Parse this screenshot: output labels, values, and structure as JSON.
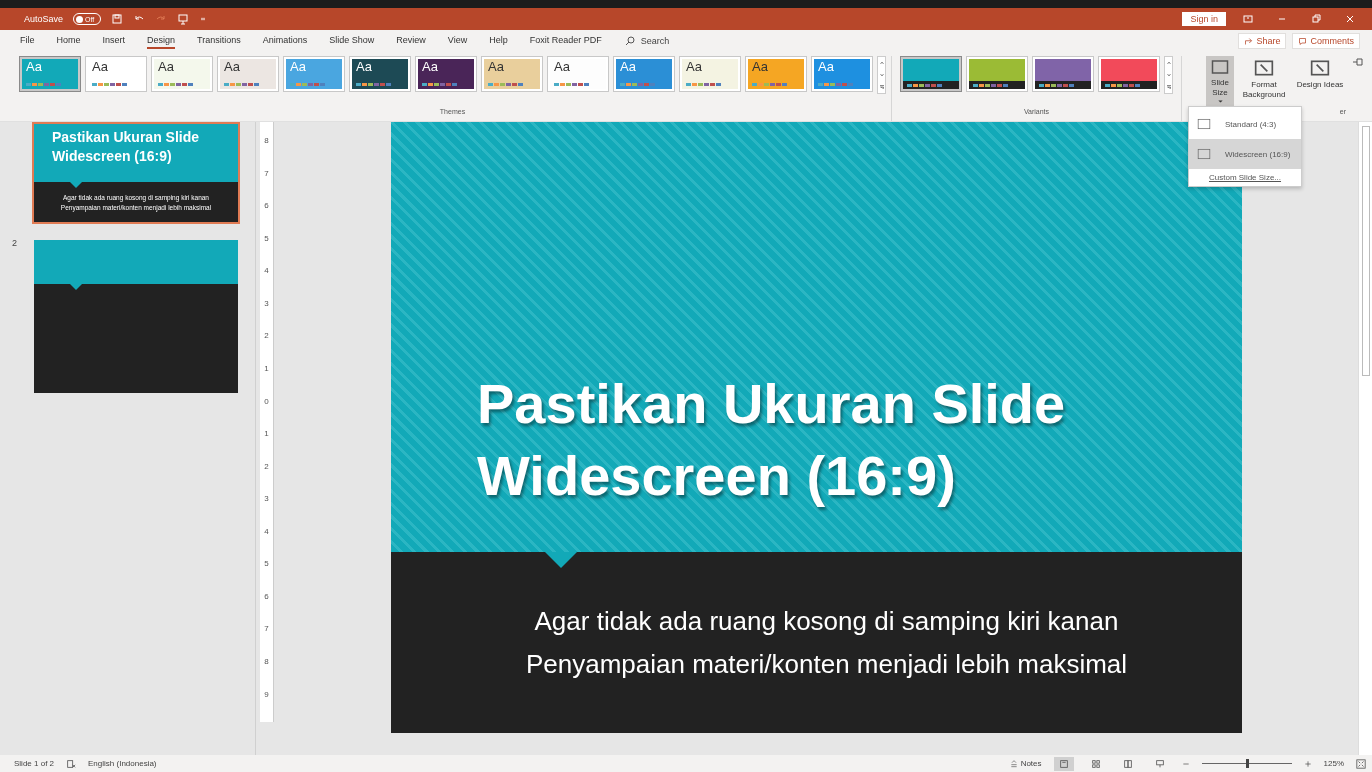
{
  "title_bar": {
    "autosave_label": "AutoSave",
    "autosave": {
      "on": false,
      "text": "Off"
    },
    "sign_in": "Sign in"
  },
  "tabs": [
    {
      "label": "File",
      "selected": false
    },
    {
      "label": "Home",
      "selected": false
    },
    {
      "label": "Insert",
      "selected": false
    },
    {
      "label": "Design",
      "selected": true
    },
    {
      "label": "Transitions",
      "selected": false
    },
    {
      "label": "Animations",
      "selected": false
    },
    {
      "label": "Slide Show",
      "selected": false
    },
    {
      "label": "Review",
      "selected": false
    },
    {
      "label": "View",
      "selected": false
    },
    {
      "label": "Help",
      "selected": false
    },
    {
      "label": "Foxit Reader PDF",
      "selected": false
    }
  ],
  "search": {
    "placeholder": "Search"
  },
  "share": "Share",
  "comments": "Comments",
  "themes": {
    "label": "Themes",
    "items": [
      {
        "label": "Aa",
        "color": "#12a9b8",
        "selected": true
      },
      {
        "label": "Aa",
        "color": "#ffffff",
        "selected": false
      },
      {
        "label": "Aa",
        "color": "#f4f8ec",
        "selected": false
      },
      {
        "label": "Aa",
        "color": "#ece6e2",
        "selected": false
      },
      {
        "label": "Aa",
        "color": "#4aa6e0",
        "selected": false
      },
      {
        "label": "Aa",
        "color": "#1d4a55",
        "selected": false
      },
      {
        "label": "Aa",
        "color": "#4a2558",
        "selected": false
      },
      {
        "label": "Aa",
        "color": "#e9cf9c",
        "selected": false
      },
      {
        "label": "Aa",
        "color": "#fdfdfd",
        "selected": false
      },
      {
        "label": "Aa",
        "color": "#2b8fd6",
        "selected": false
      },
      {
        "label": "Aa",
        "color": "#f4f3e2",
        "selected": false
      },
      {
        "label": "Aa",
        "color": "#f5a623",
        "selected": false
      },
      {
        "label": "Aa",
        "color": "#1e90e0",
        "selected": false
      }
    ]
  },
  "variants": {
    "label": "Variants",
    "items": [
      {
        "color": "#12a9b8",
        "selected": true
      },
      {
        "color": "#9bbb35",
        "selected": false
      },
      {
        "color": "#8064a8",
        "selected": false
      },
      {
        "color": "#f24a5a",
        "selected": false
      }
    ]
  },
  "customize": {
    "label": "er",
    "buttons": [
      {
        "label": "Slide Size",
        "dropdown": true,
        "selected": true
      },
      {
        "label": "Format Background",
        "dropdown": false,
        "selected": false
      },
      {
        "label": "Design Ideas",
        "dropdown": false,
        "selected": false
      }
    ]
  },
  "slide_size_menu": {
    "items": [
      {
        "label": "Standard (4:3)",
        "selected": false
      },
      {
        "label": "Widescreen (16:9)",
        "selected": true
      }
    ],
    "custom": "Custom Slide Size..."
  },
  "thumbnails": [
    {
      "selected": true,
      "title": "Pastikan Ukuran Slide Widescreen (16:9)",
      "lines": [
        "Agar tidak ada ruang kosong di samping kiri kanan",
        "Penyampaian materi/konten menjadi lebih maksimal"
      ]
    },
    {
      "number": "2",
      "selected": false
    }
  ],
  "ruler": [
    "8",
    "7",
    "6",
    "5",
    "4",
    "3",
    "2",
    "1",
    "0",
    "1",
    "2",
    "3",
    "4",
    "5",
    "6",
    "7",
    "8",
    "9"
  ],
  "slide": {
    "title": "Pastikan Ukuran Slide Widescreen (16:9)",
    "lines": [
      "Agar tidak ada ruang kosong di samping kiri kanan",
      "Penyampaian materi/konten menjadi lebih maksimal"
    ]
  },
  "status_bar": {
    "slide": "Slide 1 of 2",
    "language": "English (Indonesia)",
    "notes": "Notes",
    "views": [
      {
        "kind": "normal",
        "selected": true
      },
      {
        "kind": "sorter",
        "selected": false
      },
      {
        "kind": "reading",
        "selected": false
      },
      {
        "kind": "show",
        "selected": false
      }
    ],
    "zoom": {
      "level": 0.5,
      "text": "125%"
    }
  }
}
